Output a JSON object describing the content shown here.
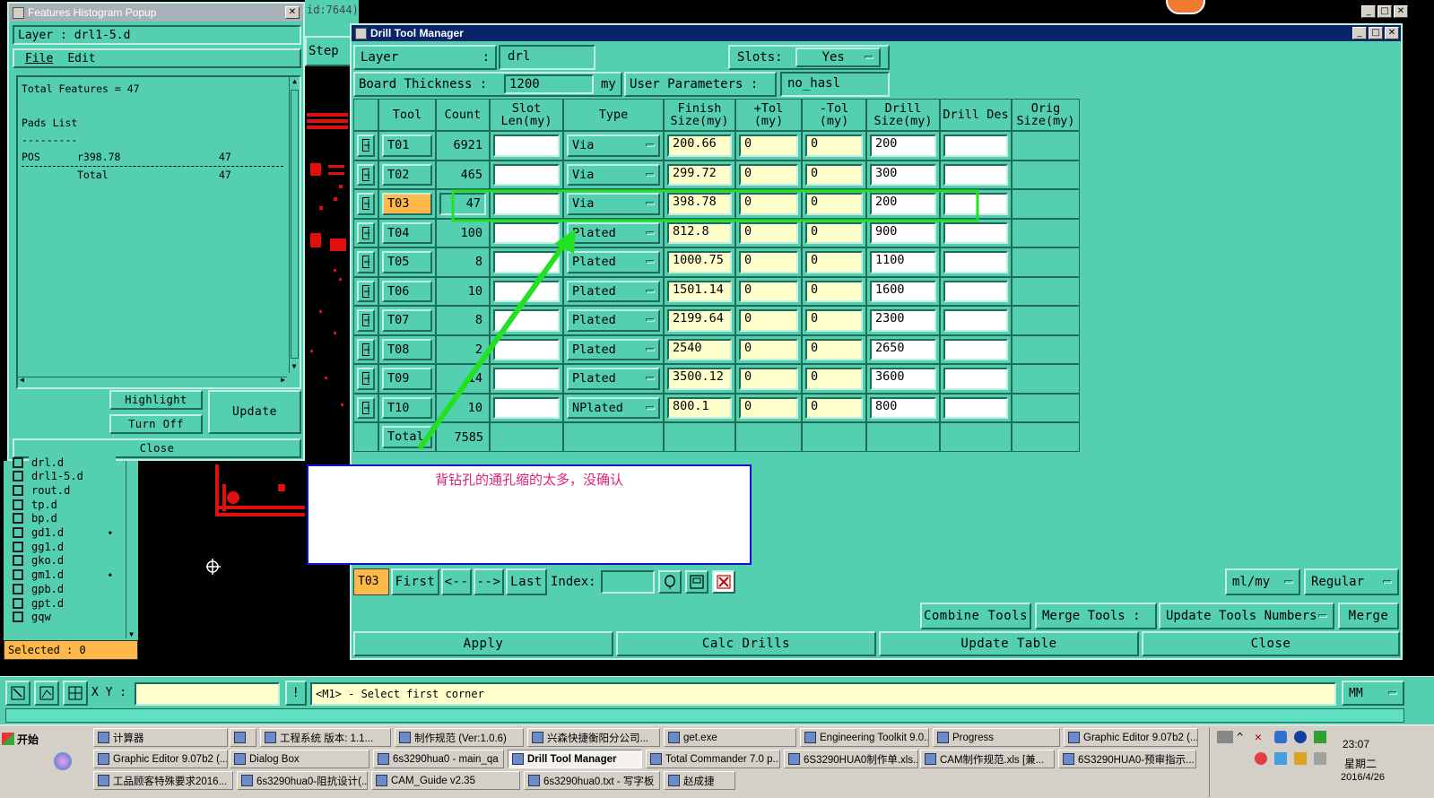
{
  "bg_window": {
    "title_fragment": "id:7644)",
    "step_label": "Step"
  },
  "popup": {
    "title": "Features Histogram Popup",
    "layer_label": "Layer :",
    "layer_value": "drl1-5.d",
    "menu": [
      "File",
      "Edit"
    ],
    "lines": [
      {
        "a": "Total Features = 47",
        "b": "",
        "c": ""
      },
      {
        "a": "",
        "b": "",
        "c": ""
      },
      {
        "a": "Pads List",
        "b": "",
        "c": ""
      },
      {
        "a": "---------",
        "b": "",
        "c": ""
      },
      {
        "a": "POS",
        "b": "r398.78",
        "c": "47"
      },
      {
        "a": "",
        "b": "Total",
        "c": "47"
      }
    ],
    "highlight_label": "Highlight",
    "turnoff_label": "Turn Off",
    "update_label": "Update",
    "close_label": "Close"
  },
  "layers": {
    "items": [
      "drl.d",
      "drl1-5.d",
      "rout.d",
      "tp.d",
      "bp.d",
      "gd1.d",
      "gg1.d",
      "gko.d",
      "gm1.d",
      "gpb.d",
      "gpt.d",
      "gqw"
    ],
    "selected_label": "Selected : 0"
  },
  "dtm": {
    "title": "Drill Tool Manager",
    "layer_label": "Layer",
    "layer_colon": ":",
    "layer_value": "drl",
    "slots_label": "Slots:",
    "slots_value": "Yes",
    "board_label": "Board Thickness :",
    "board_value": "1200",
    "board_unit": "my",
    "userparam_label": "User Parameters :",
    "userparam_value": "no_hasl",
    "headers": [
      "Tool",
      "Count",
      "Slot Len(my)",
      "Type",
      "Finish Size(my)",
      "+Tol (my)",
      "-Tol (my)",
      "Drill Size(my)",
      "Drill Des",
      "Orig Size(my)"
    ],
    "rows": [
      {
        "tool": "T01",
        "count": "6921",
        "slot": "",
        "type": "Via",
        "finish": "200.66",
        "ptol": "0",
        "mtol": "0",
        "drill": "200",
        "des": ""
      },
      {
        "tool": "T02",
        "count": "465",
        "slot": "",
        "type": "Via",
        "finish": "299.72",
        "ptol": "0",
        "mtol": "0",
        "drill": "300",
        "des": ""
      },
      {
        "tool": "T03",
        "count": "47",
        "slot": "",
        "type": "Via",
        "finish": "398.78",
        "ptol": "0",
        "mtol": "0",
        "drill": "200",
        "des": ""
      },
      {
        "tool": "T04",
        "count": "100",
        "slot": "",
        "type": "Plated",
        "finish": "812.8",
        "ptol": "0",
        "mtol": "0",
        "drill": "900",
        "des": ""
      },
      {
        "tool": "T05",
        "count": "8",
        "slot": "",
        "type": "Plated",
        "finish": "1000.75",
        "ptol": "0",
        "mtol": "0",
        "drill": "1100",
        "des": ""
      },
      {
        "tool": "T06",
        "count": "10",
        "slot": "",
        "type": "Plated",
        "finish": "1501.14",
        "ptol": "0",
        "mtol": "0",
        "drill": "1600",
        "des": ""
      },
      {
        "tool": "T07",
        "count": "8",
        "slot": "",
        "type": "Plated",
        "finish": "2199.64",
        "ptol": "0",
        "mtol": "0",
        "drill": "2300",
        "des": ""
      },
      {
        "tool": "T08",
        "count": "2",
        "slot": "",
        "type": "Plated",
        "finish": "2540",
        "ptol": "0",
        "mtol": "0",
        "drill": "2650",
        "des": ""
      },
      {
        "tool": "T09",
        "count": "14",
        "slot": "",
        "type": "Plated",
        "finish": "3500.12",
        "ptol": "0",
        "mtol": "0",
        "drill": "3600",
        "des": ""
      },
      {
        "tool": "T10",
        "count": "10",
        "slot": "",
        "type": "NPlated",
        "finish": "800.1",
        "ptol": "0",
        "mtol": "0",
        "drill": "800",
        "des": ""
      }
    ],
    "total_label": "Total",
    "total_value": "7585",
    "annotation": "背钻孔的通孔缩的太多，没确认",
    "nav": {
      "current": "T03",
      "first": "First",
      "prev": "<--",
      "next": "-->",
      "last": "Last",
      "index_label": "Index:",
      "index_value": ""
    },
    "units_value": "ml/my",
    "mode_value": "Regular",
    "combine_label": "Combine Tools",
    "merge_tools_label": "Merge Tools :",
    "update_numbers_label": "Update Tools Numbers",
    "merge_label": "Merge",
    "apply_label": "Apply",
    "calc_label": "Calc Drills",
    "update_table_label": "Update Table",
    "close_label": "Close"
  },
  "status": {
    "xy_label": "X Y :",
    "xy_value": "",
    "message": "<M1> - Select first corner",
    "units": "MM"
  },
  "taskbar": {
    "start": "开始",
    "row1": [
      "计算器",
      "",
      "工程系统  版本: 1.1...",
      "制作规范 (Ver:1.0.6)",
      "兴森快捷衡阳分公司...",
      "get.exe",
      "Engineering Toolkit 9.0...",
      "Progress",
      "Graphic Editor 9.07b2 (..."
    ],
    "row2": [
      "Graphic Editor 9.07b2 (...",
      "Dialog Box",
      "6s3290hua0 - main_qa",
      "Drill Tool Manager",
      "Total Commander 7.0 p...",
      "6S3290HUA0制作单.xls...",
      "CAM制作规范.xls [兼...",
      "6S3290HUA0-预审指示..."
    ],
    "row3": [
      "工品顾客特殊要求2016...",
      "6s3290hua0-阻抗设计(...",
      "CAM_Guide v2.35",
      "6s3290hua0.txt - 写字板",
      "赵成捷"
    ],
    "clock": "23:07",
    "weekday": "星期二",
    "date": "2016/4/26"
  },
  "colors": {
    "teal": "#54cfb0",
    "highlight": "#ffb84a",
    "annotation": "#e0207a",
    "arrow": "#22e022"
  }
}
